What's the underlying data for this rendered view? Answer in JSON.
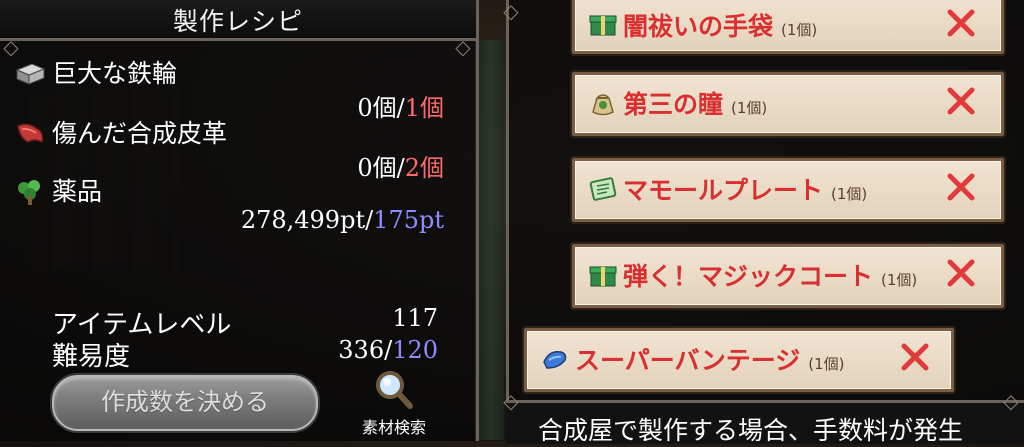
{
  "recipe": {
    "title": "製作レシピ",
    "materials": [
      {
        "name": "巨大な鉄輪",
        "have": "0個/",
        "need": "1個",
        "icon": "iron-ring-icon"
      },
      {
        "name": "傷んだ合成皮革",
        "have": "0個/",
        "need": "2個",
        "icon": "leather-icon"
      },
      {
        "name": "薬品",
        "have": "278,499pt/",
        "need": "175pt",
        "icon": "herb-icon"
      }
    ],
    "item_level_label": "アイテムレベル",
    "item_level_value": "117",
    "difficulty_label": "難易度",
    "difficulty_have": "336/",
    "difficulty_need": "120",
    "decide_button": "作成数を決める",
    "search_label": "素材検索"
  },
  "craft_list": [
    {
      "name": "闇祓いの手袋",
      "qty": "(1個)",
      "icon": "gift-box-icon"
    },
    {
      "name": "第三の瞳",
      "qty": "(1個)",
      "icon": "pouch-icon"
    },
    {
      "name": "マモールプレート",
      "qty": "(1個)",
      "icon": "plate-icon"
    },
    {
      "name": "弾く！マジックコート",
      "qty": "(1個)",
      "icon": "gift-box-icon"
    },
    {
      "name": "スーパーバンテージ",
      "qty": "(1個)",
      "icon": "bandage-icon"
    }
  ],
  "bottom_notice": "合成屋で製作する場合、手数料が発生",
  "colors": {
    "need_red": "#ff6a6a",
    "need_blue": "#8c8cff",
    "item_text": "#d83030",
    "remove_x": "#e23a3a"
  }
}
